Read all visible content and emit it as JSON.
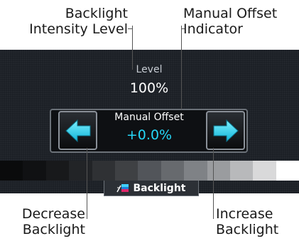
{
  "callouts": {
    "intensity_line1": "Backlight",
    "intensity_line2": "Intensity Level",
    "offset_line1": "Manual Offset",
    "offset_line2": "Indicator",
    "decrease_line1": "Decrease",
    "decrease_line2": "Backlight",
    "increase_line1": "Increase",
    "increase_line2": "Backlight"
  },
  "level": {
    "label": "Level",
    "value": "100%"
  },
  "manual_offset": {
    "label": "Manual Offset",
    "value": "+0.0%"
  },
  "buttons": {
    "decrease_icon": "arrow-left-icon",
    "increase_icon": "arrow-right-icon"
  },
  "swatch_colors": [
    "#0a0b0c",
    "#101113",
    "#18191b",
    "#222427",
    "#2f3134",
    "#3f4144",
    "#52555a",
    "#676a6e",
    "#7f8286",
    "#9a9c9f",
    "#b8b9bb",
    "#d9d9da",
    "#ffffff"
  ],
  "tab": {
    "label": "Backlight",
    "icon": "backlight-icon"
  },
  "colors": {
    "accent_cyan": "#25d7f7",
    "screen_bg": "#1c2026"
  }
}
